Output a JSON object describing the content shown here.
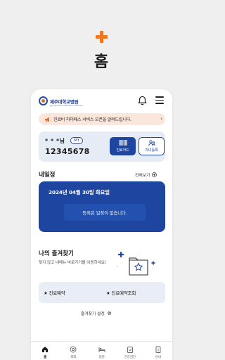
{
  "hero": {
    "title": "홈",
    "accent": "#f07722"
  },
  "header": {
    "logo_text": "제주대학교병원",
    "logo_sub": "JEJU NATIONAL UNIVERSITY HOSPITAL"
  },
  "notice": {
    "text": "진료비 하이패스 서비스 오픈을 알려드립니다."
  },
  "user": {
    "name": "* * *님",
    "badge": "MY",
    "patient_number": "12345678",
    "card_button": "진료카드",
    "child_button": "자녀등록"
  },
  "schedule": {
    "title": "내일정",
    "view_all": "전체보기",
    "date": "2024년 04월 30일 화요일",
    "empty_message": "등록된 일정이 없습니다."
  },
  "favorites": {
    "title": "나의 즐겨찾기",
    "description": "찾지 않고 내메뉴 바로가기를 이용하세요!",
    "items": [
      "★ 진료예약",
      "★ 진료예약조회"
    ],
    "settings": "즐겨찾기 설정"
  },
  "bottom_nav": [
    {
      "label": "홈",
      "icon": "home-icon",
      "active": true
    },
    {
      "label": "외래",
      "icon": "outpatient-icon",
      "active": false
    },
    {
      "label": "입원",
      "icon": "bed-icon",
      "active": false
    },
    {
      "label": "건강검진",
      "icon": "checkup-icon",
      "active": false
    },
    {
      "label": "안내",
      "icon": "info-icon",
      "active": false
    }
  ],
  "colors": {
    "primary": "#1e45a0",
    "accent": "#f07722",
    "notice_bg": "#fbe6dc",
    "card_bg": "#e6ecf5"
  }
}
